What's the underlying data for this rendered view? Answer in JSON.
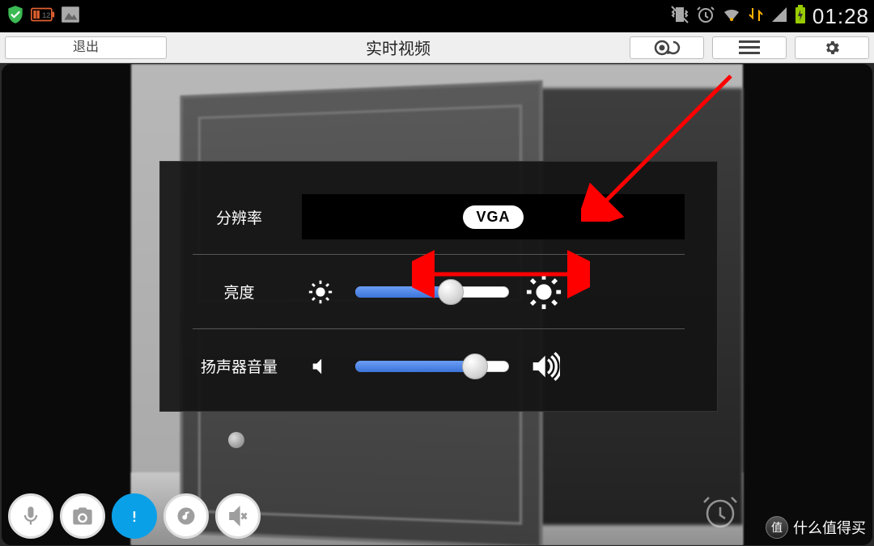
{
  "status": {
    "time": "01:28",
    "icons": {
      "shield": "antivirus-shield",
      "battery_badge": "battery-app",
      "gallery": "gallery-app",
      "vibrate": "vibrate-mode",
      "alarm": "alarm-set",
      "wifi": "wifi-connected",
      "net": "mobile-data",
      "signal": "cell-signal",
      "charging": "battery-charging"
    }
  },
  "toolbar": {
    "exit_label": "退出",
    "title": "实时视频",
    "buttons": {
      "rotate": "camera-rotate",
      "menu": "menu",
      "settings": "settings"
    }
  },
  "panel": {
    "resolution_label": "分辨率",
    "resolution_value": "VGA",
    "brightness_label": "亮度",
    "brightness_percent": 62,
    "volume_label": "扬声器音量",
    "volume_percent": 78
  },
  "bottom": {
    "items": [
      "mic",
      "camera",
      "alert",
      "music",
      "mute"
    ],
    "active_index": 2
  },
  "watermark": {
    "badge": "值",
    "text": "什么值得买"
  }
}
